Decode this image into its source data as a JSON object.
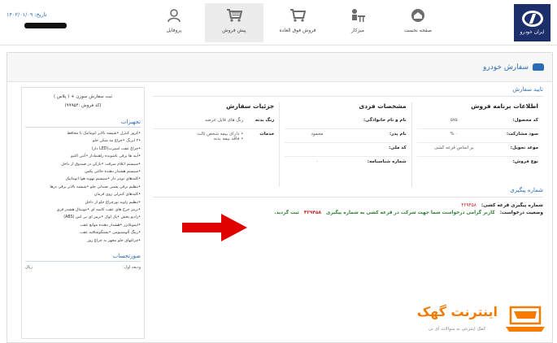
{
  "header": {
    "date_label": "تاریخ: ۱۴۰۲/۰۱/۰۹",
    "logo_text": "ایران خودرو",
    "nav": [
      {
        "label": "صفحه نخست",
        "icon": "home-icon"
      },
      {
        "label": "میزکار",
        "icon": "desk-icon"
      },
      {
        "label": "فروش فوق العاده",
        "icon": "cart-special-icon"
      },
      {
        "label": "پیش فروش",
        "icon": "cart-icon",
        "active": true
      },
      {
        "label": "پروفایل",
        "icon": "user-icon"
      }
    ]
  },
  "page": {
    "title": "سفارش خودرو",
    "confirm_section": "تایید سفارش",
    "tracking_section": "شماره پیگیری"
  },
  "sales_plan": {
    "heading": "اطلاعات برنامه فروش",
    "rows": [
      {
        "k": "کد محصول:",
        "v": "۵۷۵"
      },
      {
        "k": "سود مشارکت:",
        "v": "۰ %"
      },
      {
        "k": "موعد تحویل:",
        "v": "بر اساس قرعه کشی"
      },
      {
        "k": "نوع فروش:",
        "v": ""
      }
    ]
  },
  "personal": {
    "heading": "مشخصات فردی",
    "rows": [
      {
        "k": "نام و نام خانوادگی:",
        "v": ""
      },
      {
        "k": "نام پدر:",
        "v": "محمود"
      },
      {
        "k": "کد ملی:",
        "v": ""
      },
      {
        "k": "شماره شناسنامه:",
        "v": "۰"
      }
    ]
  },
  "order_details": {
    "heading": "جزئیات سفارش",
    "body_color_label": "رنگ بدنه",
    "body_color_value": "رنگ های قابل عرضه",
    "services_label": "خدمات",
    "services": [
      "دارای بیمه شخص ثالث",
      "فاقد بیمه بدنه"
    ]
  },
  "tracking": {
    "lottery_label": "شماره پیگیری قرعه کشی:",
    "lottery_number": "۴۲۹۴۵۸",
    "status_label": "وضعیت درخواست:",
    "status_text": "کاربر گرامی درخواست شما جهت شرکت در قرعه کشی به شماره پیگیری",
    "status_number": "۴۲۹۴۵۸",
    "status_suffix": "ثبت گردید."
  },
  "sidebar": {
    "order_line1": "ثبت سفارش سورن + ( پلاس )",
    "order_line2": "(کد فروش :۹۹۹۵۴)",
    "equipment_heading": "تجهیزات",
    "equipment": [
      "•کروز کنترل •شیشه بالابر اتوماتیک با محافظ",
      "•۲ ایربگ •چراغ مه شکن جلو",
      "•چراغ عقب اسپرت(LED دار)",
      "•آینه ها برقی تاشونده راهنمادار •آنتن اکتیو",
      "•سیستم اعلام سرقت •بازکن در صندوق از داخل",
      "•سیستم هشدار دهنده حالتی پکس",
      "•کلیدهای تویتر دار •سیستم تهویه هوا اتوماتیک",
      "•تنظیم برقی پشتی صندلی جلو •شیشه بالابر برقی درها",
      "•کلیدهای کنترلی روی فرمان",
      "•تنظیم زاویه نورچراغ جلو از داخل",
      "•ترمز چرخ های عقب کاسه ای •مونیتال هشدر فری",
      "•رادیو پخش •پک لوک •ترمز ای بی اس (ABS)",
      "•ایموبلایزر •هشدار دهنده موانع عقب",
      "•رینگ آلومینیومی •پشتگوشاقیه عقب",
      "•چراغهای جلو مجهز به چراغ روز"
    ],
    "summary_heading": "صورتحساب",
    "summary_rows": [
      {
        "k": "ودیعه اول:",
        "v": "ریال"
      }
    ]
  },
  "watermark": {
    "brand": "اینترنت گهک",
    "tagline": "کمک اینترنتی به سوالات آی تی"
  },
  "colors": {
    "accent": "#2a6db5",
    "arrow": "#e00000",
    "tracking_red": "#c62828",
    "status_green": "#2e7d32",
    "brand_blue": "#1c2f6b",
    "watermark_orange": "#f57c00"
  }
}
